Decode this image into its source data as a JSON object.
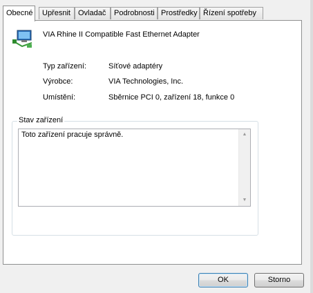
{
  "tabs": [
    {
      "label": "Obecné",
      "active": true
    },
    {
      "label": "Upřesnit"
    },
    {
      "label": "Ovladač"
    },
    {
      "label": "Podrobnosti"
    },
    {
      "label": "Prostředky"
    },
    {
      "label": "Řízení spotřeby"
    }
  ],
  "device": {
    "name": "VIA Rhine II Compatible Fast Ethernet Adapter",
    "icon": "network-adapter-icon"
  },
  "properties": {
    "type_label": "Typ zařízení:",
    "type_value": "Síťové adaptéry",
    "vendor_label": "Výrobce:",
    "vendor_value": "VIA Technologies, Inc.",
    "location_label": "Umístění:",
    "location_value": "Sběrnice PCI 0, zařízení 18, funkce 0"
  },
  "status": {
    "title": "Stav zařízení",
    "text": "Toto zařízení pracuje správně."
  },
  "buttons": {
    "ok": "OK",
    "close": "Storno"
  }
}
